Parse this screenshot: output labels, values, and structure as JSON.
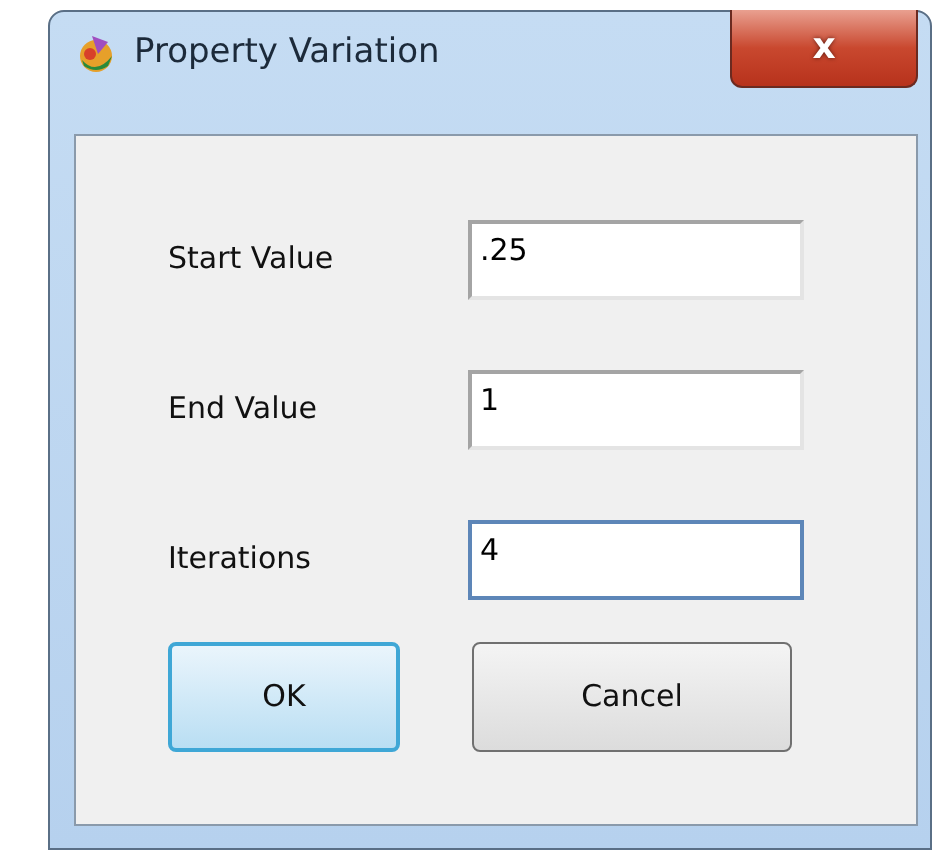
{
  "window": {
    "title": "Property Variation",
    "close_label": "x"
  },
  "fields": [
    {
      "label": "Start Value",
      "value": ".25",
      "focused": false
    },
    {
      "label": "End Value",
      "value": "1",
      "focused": false
    },
    {
      "label": "Iterations",
      "value": "4",
      "focused": true
    }
  ],
  "buttons": [
    {
      "label": "OK",
      "default": true
    },
    {
      "label": "Cancel",
      "default": false
    }
  ]
}
